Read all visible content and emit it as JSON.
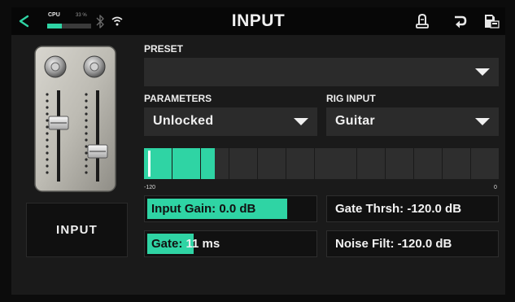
{
  "header": {
    "title": "INPUT",
    "cpu_label": "CPU",
    "cpu_percent_text": "33 %",
    "cpu_fraction": 0.33,
    "icons": [
      "back-arrow-icon",
      "bluetooth-icon",
      "wifi-icon",
      "tuner-icon",
      "undo-icon",
      "save-icon"
    ]
  },
  "sidebar": {
    "amp_image": "amp-fader-panel",
    "input_button_label": "INPUT"
  },
  "preset": {
    "label": "PRESET",
    "value": ""
  },
  "parameters": {
    "label": "PARAMETERS",
    "value": "Unlocked"
  },
  "rig_input": {
    "label": "RIG INPUT",
    "value": "Guitar"
  },
  "meter": {
    "segments_total": 25,
    "segments_lit": 5,
    "scale_min": "-120",
    "scale_max": "0"
  },
  "params": {
    "input_gain": {
      "label": "Input Gain: 0.0 dB",
      "fill_fraction": 0.84
    },
    "gate": {
      "label_filled": "Gate:",
      "label_rest": " 11 ms",
      "fill_fraction": 0.28
    },
    "gate_thresh": {
      "label": "Gate Thrsh: -120.0 dB"
    },
    "noise_filt": {
      "label": "Noise Filt: -120.0 dB"
    }
  },
  "colors": {
    "accent": "#2fd4a4",
    "background": "#1a1a1a",
    "field": "#2b2b2b"
  }
}
